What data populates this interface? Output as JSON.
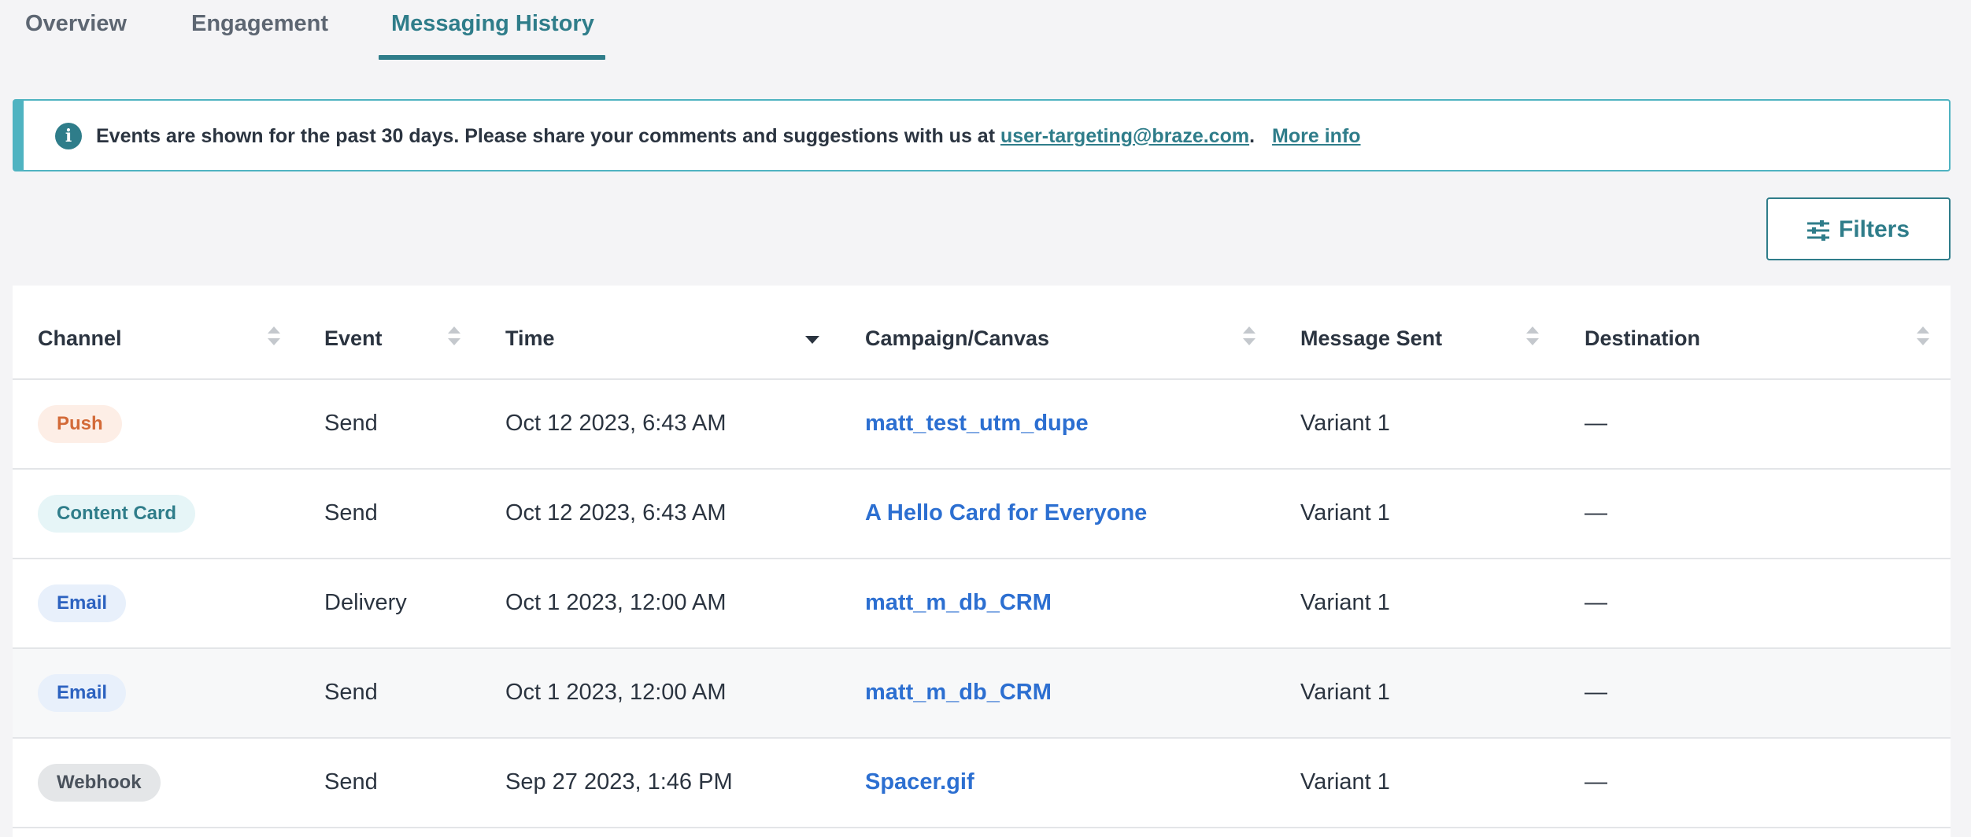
{
  "tabs": [
    {
      "label": "Overview",
      "active": false
    },
    {
      "label": "Engagement",
      "active": false
    },
    {
      "label": "Messaging History",
      "active": true
    }
  ],
  "banner": {
    "icon": "info-icon",
    "text": "Events are shown for the past 30 days. Please share your comments and suggestions with us at ",
    "email_link": "user-targeting@braze.com",
    "after_email": ".",
    "more_info": "More info"
  },
  "filters": {
    "label": "Filters",
    "icon": "sliders-icon"
  },
  "table": {
    "headers": {
      "channel": "Channel",
      "event": "Event",
      "time": "Time",
      "campaign": "Campaign/Canvas",
      "message_sent": "Message Sent",
      "destination": "Destination"
    },
    "rows": [
      {
        "channel": "Push",
        "event": "Send",
        "time": "Oct 12 2023, 6:43 AM",
        "campaign": "matt_test_utm_dupe",
        "message_sent": "Variant 1",
        "destination": "—"
      },
      {
        "channel": "Content Card",
        "event": "Send",
        "time": "Oct 12 2023, 6:43 AM",
        "campaign": "A Hello Card for Everyone",
        "message_sent": "Variant 1",
        "destination": "—"
      },
      {
        "channel": "Email",
        "event": "Delivery",
        "time": "Oct 1 2023, 12:00 AM",
        "campaign": "matt_m_db_CRM",
        "message_sent": "Variant 1",
        "destination": "—"
      },
      {
        "channel": "Email",
        "event": "Send",
        "time": "Oct 1 2023, 12:00 AM",
        "campaign": "matt_m_db_CRM",
        "message_sent": "Variant 1",
        "destination": "—"
      },
      {
        "channel": "Webhook",
        "event": "Send",
        "time": "Sep 27 2023, 1:46 PM",
        "campaign": "Spacer.gif",
        "message_sent": "Variant 1",
        "destination": "—"
      }
    ]
  },
  "colors": {
    "accent": "#2f7d8a",
    "link": "#2c6fd1",
    "push": "#d36a38",
    "email": "#2c62c0",
    "webhook": "#4a525c"
  }
}
